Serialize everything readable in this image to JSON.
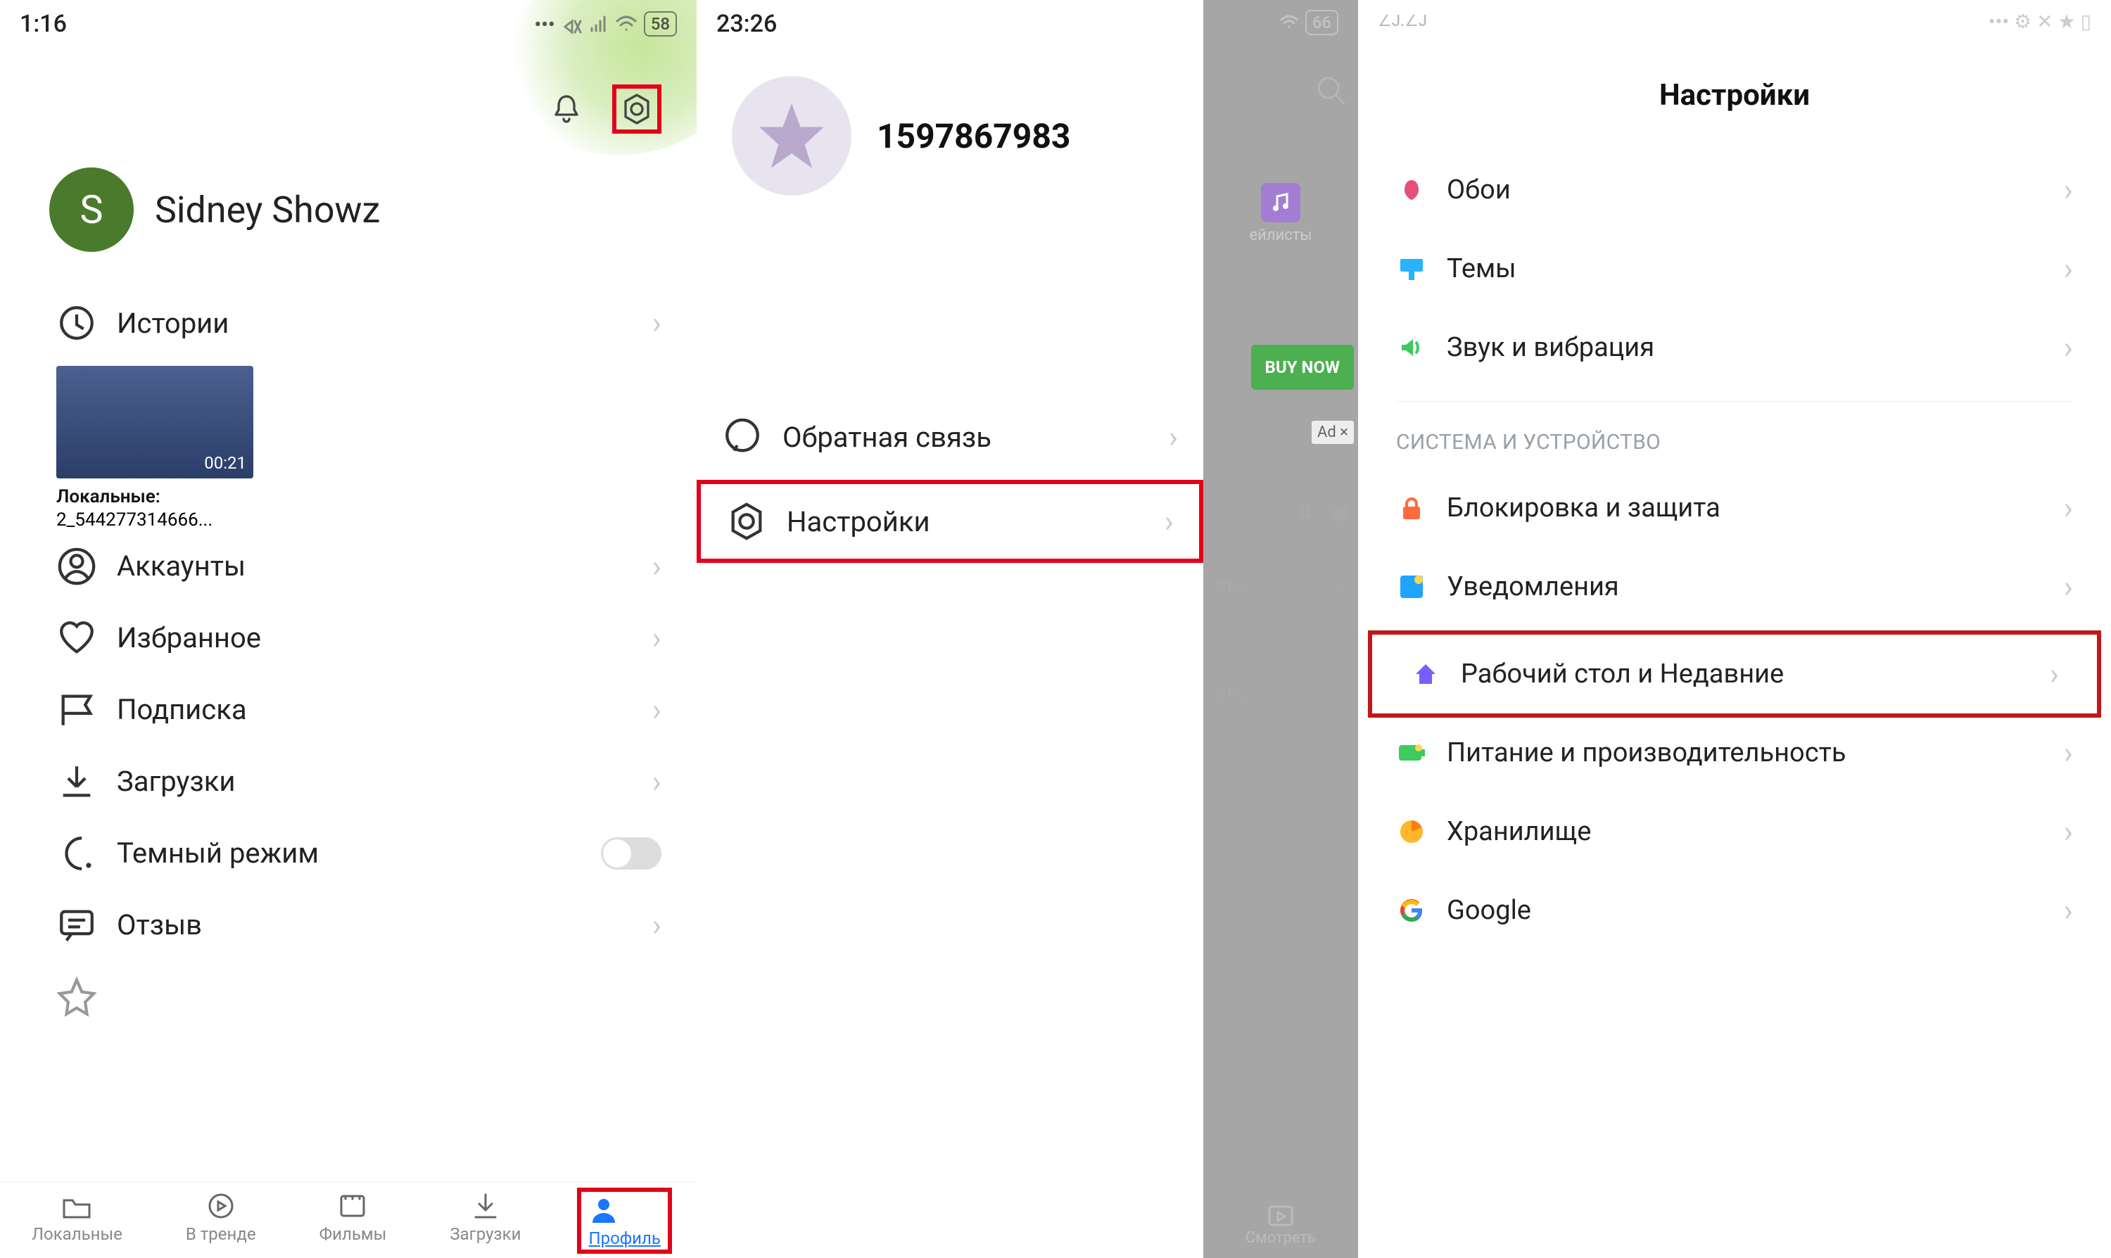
{
  "screen1": {
    "status_time": "1:16",
    "battery": "58",
    "user_initial": "S",
    "username": "Sidney Showz",
    "stories_label": "Истории",
    "video_duration": "00:21",
    "video_caption_line1": "Локальные:",
    "video_caption_line2": "2_544277314666...",
    "accounts_label": "Аккаунты",
    "favorites_label": "Избранное",
    "subscription_label": "Подписка",
    "downloads_label": "Загрузки",
    "dark_mode_label": "Темный режим",
    "feedback_label": "Отзыв",
    "nav": {
      "local": "Локальные",
      "trending": "В тренде",
      "movies": "Фильмы",
      "downloads": "Загрузки",
      "profile": "Профиль"
    }
  },
  "screen2": {
    "status_time": "23:26",
    "battery": "66",
    "user_id": "1597867983",
    "feedback_label": "Обратная связь",
    "settings_label": "Настройки",
    "buy_label": "BUY NOW",
    "ad_label": "Ad ×",
    "playlists_hint": "ейлисты",
    "list_hint1": "ст...",
    "list_hint2": "ст...",
    "watch_label": "Смотреть"
  },
  "screen3": {
    "header": "Настройки",
    "wallpaper": "Обои",
    "themes": "Темы",
    "sound": "Звук и вибрация",
    "section_system": "СИСТЕМА И УСТРОЙСТВО",
    "lock": "Блокировка и защита",
    "notifications": "Уведомления",
    "home_recent": "Рабочий стол и Недавние",
    "power": "Питание и производительность",
    "storage": "Хранилище",
    "google": "Google"
  }
}
